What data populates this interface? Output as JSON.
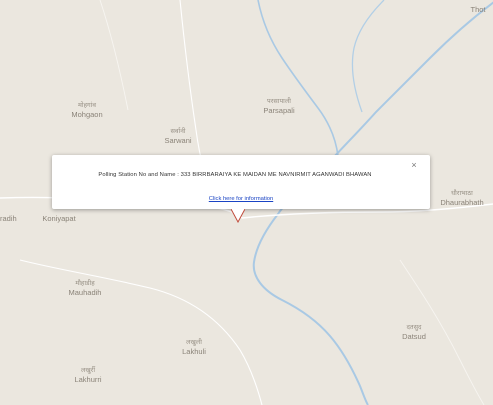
{
  "map": {
    "places": [
      {
        "id": "mohgaon",
        "native": "मोहगांव",
        "latin": "Mohgaon"
      },
      {
        "id": "sarwani",
        "native": "सर्वानी",
        "latin": "Sarwani"
      },
      {
        "id": "parsapali",
        "native": "परसापाली",
        "latin": "Parsapali"
      },
      {
        "id": "koniyapat",
        "native": "",
        "latin": "Koniyapat"
      },
      {
        "id": "mauhadih",
        "native": "मौहाडीह",
        "latin": "Mauhadih"
      },
      {
        "id": "lakhuli",
        "native": "लखुली",
        "latin": "Lakhuli"
      },
      {
        "id": "lakhurri",
        "native": "लखुर्री",
        "latin": "Lakhurri"
      },
      {
        "id": "datsud",
        "native": "दतसुद",
        "latin": "Datsud"
      },
      {
        "id": "dhaurabhath",
        "native": "धौराभाठा",
        "latin": "Dhaurabhath"
      },
      {
        "id": "thot",
        "native": "",
        "latin": "Thot"
      },
      {
        "id": "west",
        "native": "",
        "latin": "radih"
      }
    ],
    "colors": {
      "background": "#ebe7df",
      "river": "#9ec1df",
      "road": "#ffffff"
    }
  },
  "infowindow": {
    "text": "Polling Station No and Name : 333 BIRRBARAIYA KE MAIDAN ME NAVNIRMIT AGANWADI BHAWAN",
    "link": "Click here for information",
    "close": "×"
  },
  "marker": {
    "icon": "map-pin-icon"
  }
}
